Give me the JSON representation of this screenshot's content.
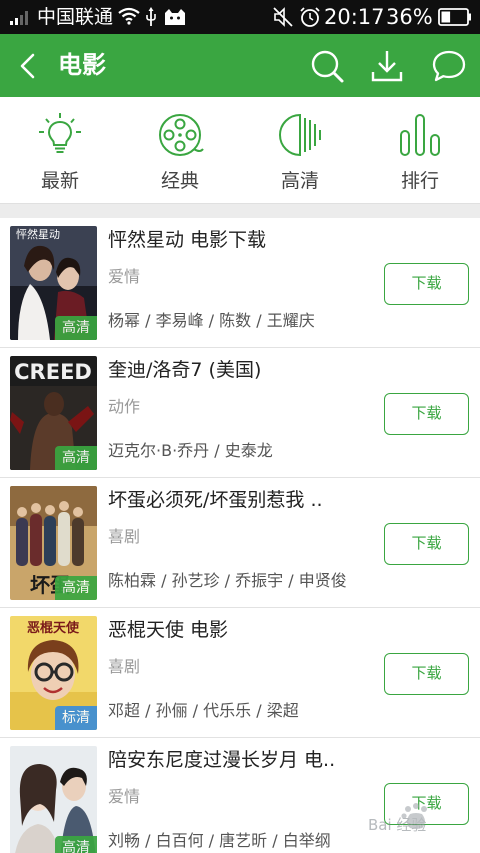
{
  "status_bar": {
    "carrier": "中国联通",
    "time": "20:17",
    "battery_percent": "36%",
    "battery_level": 0.36
  },
  "header": {
    "title": "电影",
    "icons": [
      "back-icon",
      "search-icon",
      "download-icon",
      "message-icon"
    ]
  },
  "categories": [
    {
      "label": "最新",
      "icon": "lightbulb-icon"
    },
    {
      "label": "经典",
      "icon": "film-reel-icon"
    },
    {
      "label": "高清",
      "icon": "hd-half-circle-icon"
    },
    {
      "label": "排行",
      "icon": "ranking-bars-icon"
    }
  ],
  "accent_color": "#3aa641",
  "movies": [
    {
      "title": "怦然星动  电影下载",
      "genre": "爱情",
      "cast": "杨幂 / 李易峰 / 陈数 / 王耀庆",
      "quality": "高清",
      "download_label": "下载",
      "poster_text": "怦然星动"
    },
    {
      "title": "奎迪/洛奇7 (美国)",
      "genre": "动作",
      "cast": "迈克尔·B·乔丹 / 史泰龙",
      "quality": "高清",
      "download_label": "下载",
      "poster_text": "CREED"
    },
    {
      "title": "坏蛋必须死/坏蛋别惹我 ..",
      "genre": "喜剧",
      "cast": "陈柏霖 / 孙艺珍 / 乔振宇 / 申贤俊",
      "quality": "高清",
      "download_label": "下载",
      "poster_text": "坏蛋"
    },
    {
      "title": "恶棍天使 电影",
      "genre": "喜剧",
      "cast": "邓超 / 孙俪 / 代乐乐 / 梁超",
      "quality": "标清",
      "download_label": "下载",
      "poster_text": "恶棍天使"
    },
    {
      "title": "陪安东尼度过漫长岁月 电..",
      "genre": "爱情",
      "cast": "刘畅 / 白百何 / 唐艺昕 / 白举纲",
      "quality": "高清",
      "download_label": "下载",
      "poster_text": ""
    }
  ],
  "watermark": "Bai 经验"
}
